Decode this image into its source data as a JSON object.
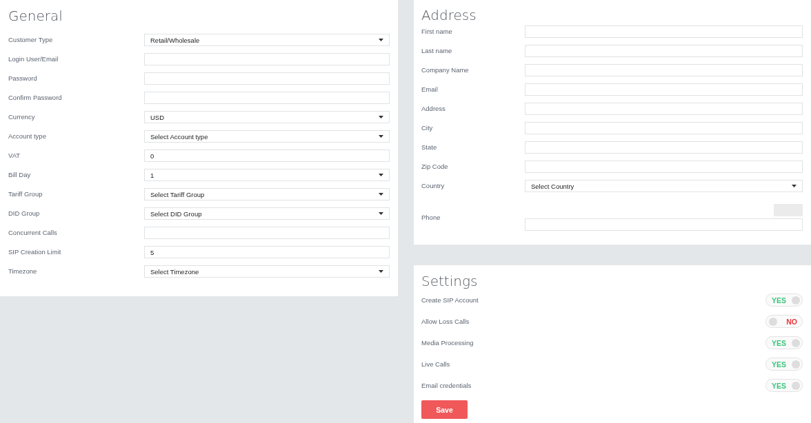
{
  "general": {
    "title": "General",
    "fields": [
      {
        "label": "Customer Type",
        "kind": "select",
        "value": "Retail/Wholesale"
      },
      {
        "label": "Login User/Email",
        "kind": "text"
      },
      {
        "label": "Password",
        "kind": "text"
      },
      {
        "label": "Confirm Password",
        "kind": "text"
      },
      {
        "label": "Currency",
        "kind": "select",
        "value": "USD"
      },
      {
        "label": "Account type",
        "kind": "select",
        "value": "Select Account type"
      },
      {
        "label": "VAT",
        "kind": "text",
        "value": "0"
      },
      {
        "label": "Bill Day",
        "kind": "select",
        "value": "1"
      },
      {
        "label": "Tariff Group",
        "kind": "select",
        "value": "Select Tariff Group"
      },
      {
        "label": "DID Group",
        "kind": "select",
        "value": "Select DID Group"
      },
      {
        "label": "Concurrent Calls",
        "kind": "text"
      },
      {
        "label": "SIP Creation Limit",
        "kind": "text",
        "value": "5"
      },
      {
        "label": "Timezone",
        "kind": "select",
        "value": "Select Timezone"
      }
    ]
  },
  "address": {
    "title": "Address",
    "fields": [
      {
        "label": "First name",
        "kind": "text"
      },
      {
        "label": "Last name",
        "kind": "text"
      },
      {
        "label": "Company Name",
        "kind": "text"
      },
      {
        "label": "Email",
        "kind": "text"
      },
      {
        "label": "Address",
        "kind": "text"
      },
      {
        "label": "City",
        "kind": "text"
      },
      {
        "label": "State",
        "kind": "text"
      },
      {
        "label": "Zip Code",
        "kind": "text"
      },
      {
        "label": "Country",
        "kind": "select",
        "value": "Select Country"
      },
      {
        "label": "Phone",
        "kind": "phone"
      }
    ]
  },
  "settings": {
    "title": "Settings",
    "toggles": [
      {
        "label": "Create SIP Account",
        "on": true,
        "state_label": "YES"
      },
      {
        "label": "Allow Loss Calls",
        "on": false,
        "state_label": "NO"
      },
      {
        "label": "Media Processing",
        "on": true,
        "state_label": "YES"
      },
      {
        "label": "Live Calls",
        "on": true,
        "state_label": "YES"
      },
      {
        "label": "Email credentials",
        "on": true,
        "state_label": "YES"
      }
    ],
    "save_label": "Save"
  }
}
